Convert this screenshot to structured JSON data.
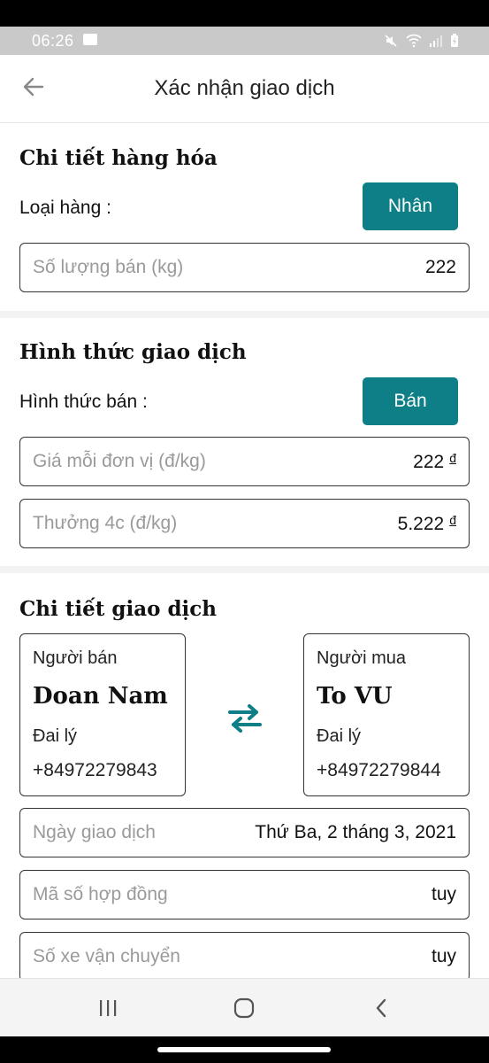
{
  "status": {
    "time": "06:26"
  },
  "header": {
    "title": "Xác nhận giao dịch"
  },
  "goods": {
    "title": "Chi tiết hàng hóa",
    "type_label": "Loại hàng :",
    "type_value": "Nhân",
    "quantity_placeholder": "Số lượng bán (kg)",
    "quantity_value": "222"
  },
  "trade": {
    "title": "Hình thức giao dịch",
    "method_label": "Hình thức bán :",
    "method_value": "Bán",
    "unit_price_placeholder": "Giá mỗi đơn vị (đ/kg)",
    "unit_price_value": "222",
    "bonus_placeholder": "Thưởng 4c (đ/kg)",
    "bonus_value": "5.222",
    "currency": "đ"
  },
  "details": {
    "title": "Chi tiết giao dịch",
    "seller": {
      "role": "Người bán",
      "name": "Doan Nam",
      "type": "Đai lý",
      "phone": "+84972279843"
    },
    "buyer": {
      "role": "Người mua",
      "name": "To VU",
      "type": "Đai lý",
      "phone": "+84972279844"
    },
    "date_placeholder": "Ngày giao dịch",
    "date_value": "Thứ Ba, 2 tháng 3, 2021",
    "contract_placeholder": "Mã số hợp đồng",
    "contract_value": "tuy",
    "vehicle_placeholder": "Số xe vận chuyển",
    "vehicle_value": "tuy"
  },
  "colors": {
    "accent": "#0e7f86"
  },
  "icons": {
    "back": "arrow-left-icon",
    "swap": "swap-arrows-icon",
    "nav_recent": "recent-apps-icon",
    "nav_home": "home-icon",
    "nav_back": "chevron-left-icon"
  }
}
